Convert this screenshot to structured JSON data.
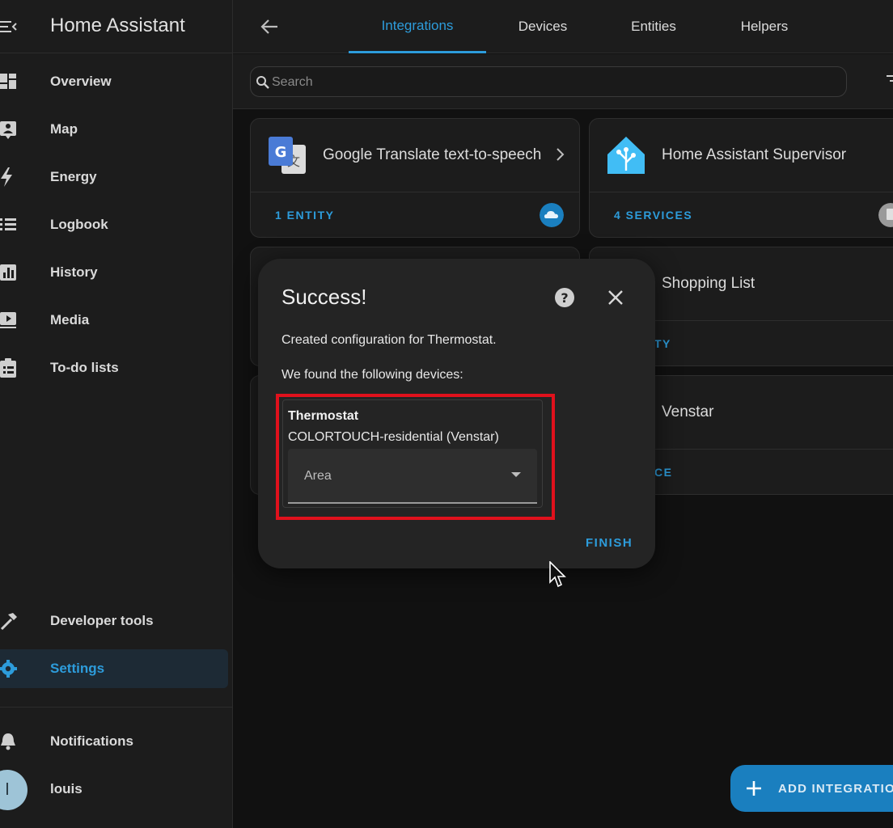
{
  "app": {
    "title": "Home Assistant"
  },
  "sidebar": {
    "items": [
      {
        "label": "Overview",
        "icon": "dashboard-icon"
      },
      {
        "label": "Map",
        "icon": "map-person-icon"
      },
      {
        "label": "Energy",
        "icon": "lightning-icon"
      },
      {
        "label": "Logbook",
        "icon": "list-icon"
      },
      {
        "label": "History",
        "icon": "chart-bar-icon"
      },
      {
        "label": "Media",
        "icon": "play-box-icon"
      },
      {
        "label": "To-do lists",
        "icon": "clipboard-list-icon"
      }
    ],
    "bottom_items": [
      {
        "label": "Developer tools",
        "icon": "hammer-icon"
      },
      {
        "label": "Settings",
        "icon": "gear-icon",
        "active": true
      }
    ],
    "notifications_label": "Notifications",
    "user": {
      "initial": "l",
      "name": "louis"
    }
  },
  "tabs": [
    {
      "label": "Integrations",
      "active": true
    },
    {
      "label": "Devices"
    },
    {
      "label": "Entities"
    },
    {
      "label": "Helpers"
    }
  ],
  "search": {
    "placeholder": "Search"
  },
  "cards": [
    {
      "name": "Google Translate text-to-speech",
      "link": "1 ENTITY"
    },
    {
      "name": "Home Assistant Supervisor",
      "link": "4 SERVICES"
    },
    {
      "name": "Shopping List",
      "link": "TY"
    },
    {
      "name": "Venstar",
      "link": "CE"
    }
  ],
  "dialog": {
    "title": "Success!",
    "message": "Created configuration for Thermostat.",
    "devices_heading": "We found the following devices:",
    "device": {
      "name": "Thermostat",
      "model": "COLORTOUCH-residential (Venstar)",
      "area_label": "Area"
    },
    "finish_label": "FINISH"
  },
  "fab": {
    "label": "ADD INTEGRATION"
  },
  "colors": {
    "accent": "#2d9cdb",
    "highlight": "#e0111c",
    "background": "#111111",
    "surface": "#1c1c1c"
  }
}
